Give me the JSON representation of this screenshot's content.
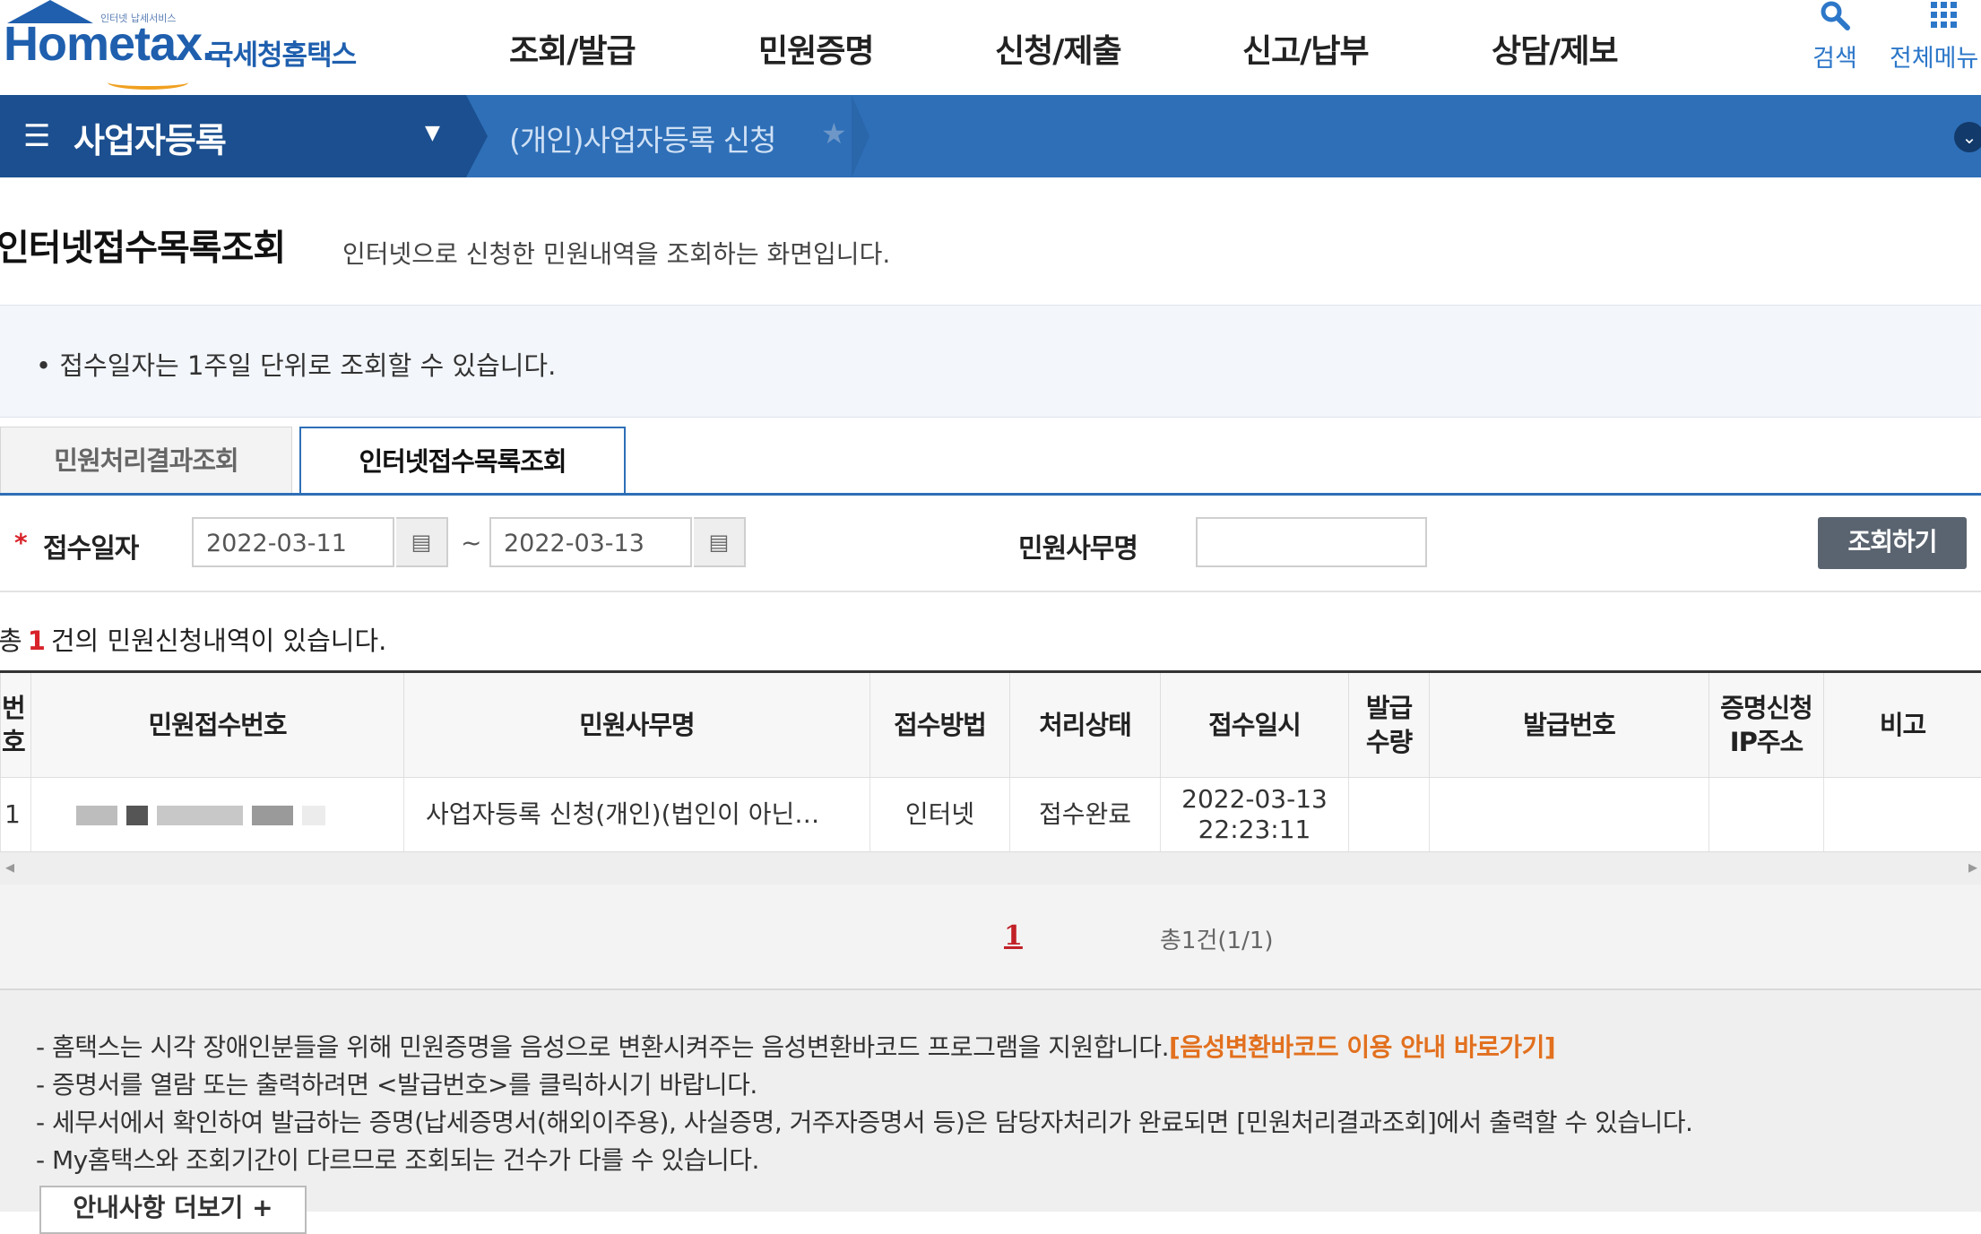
{
  "header": {
    "logo_small": "인터넷 납세서비스",
    "logo_main": "Hometax.",
    "logo_ko": "국세청홈택스",
    "gnb": [
      "조회/발급",
      "민원증명",
      "신청/제출",
      "신고/납부",
      "상담/제보"
    ],
    "search_label": "검색",
    "all_menu_label": "전체메뉴"
  },
  "nav": {
    "menu_title": "사업자등록",
    "breadcrumb": "(개인)사업자등록 신청",
    "star": "★"
  },
  "page": {
    "title": "인터넷접수목록조회",
    "description": "인터넷으로 신청한 민원내역을 조회하는 화면입니다.",
    "info": "접수일자는 1주일 단위로 조회할 수 있습니다."
  },
  "tabs": [
    {
      "label": "민원처리결과조회",
      "active": false
    },
    {
      "label": "인터넷접수목록조회",
      "active": true
    }
  ],
  "search": {
    "date_label": "접수일자",
    "date_from": "2022-03-11",
    "date_to": "2022-03-13",
    "tilde": "~",
    "service_label": "민원사무명",
    "service_value": "",
    "button": "조회하기"
  },
  "result": {
    "prefix": "총",
    "count": "1",
    "suffix": "건의 민원신청내역이 있습니다."
  },
  "table": {
    "headers": [
      "번호",
      "민원접수번호",
      "민원사무명",
      "접수방법",
      "처리상태",
      "접수일시",
      "발급 수량",
      "발급번호",
      "증명신청 IP주소",
      "비고"
    ],
    "rows": [
      {
        "no": "1",
        "receipt_no": "",
        "service": "사업자등록 신청(개인)(법인이 아닌…",
        "method": "인터넷",
        "status": "접수완료",
        "date": "2022-03-13",
        "time": "22:23:11",
        "qty": "",
        "issue_no": "",
        "ip": "",
        "note": ""
      }
    ]
  },
  "pager": {
    "current": "1",
    "total": "총1건(1/1)"
  },
  "notes": {
    "n1": "- 홈택스는 시각 장애인분들을 위해 민원증명을 음성으로 변환시켜주는 음성변환바코드 프로그램을 지원합니다.",
    "n1_link": "[음성변환바코드 이용 안내 바로가기]",
    "n2": "- 증명서를 열람 또는 출력하려면 <발급번호>를 클릭하시기 바랍니다.",
    "n3": "- 세무서에서 확인하여 발급하는 증명(납세증명서(해외이주용), 사실증명, 거주자증명서 등)은 담당자처리가 완료되면 [민원처리결과조회]에서 출력할 수 있습니다.",
    "n4": "- My홈택스와 조회기간이 다르므로 조회되는 건수가 다를 수 있습니다.",
    "more": "안내사항 더보기 +"
  },
  "colors": {
    "brand_blue": "#2e6fb7",
    "nav_dark": "#1b4f8f",
    "accent_red": "#d8232a",
    "link_orange": "#e2701e"
  }
}
